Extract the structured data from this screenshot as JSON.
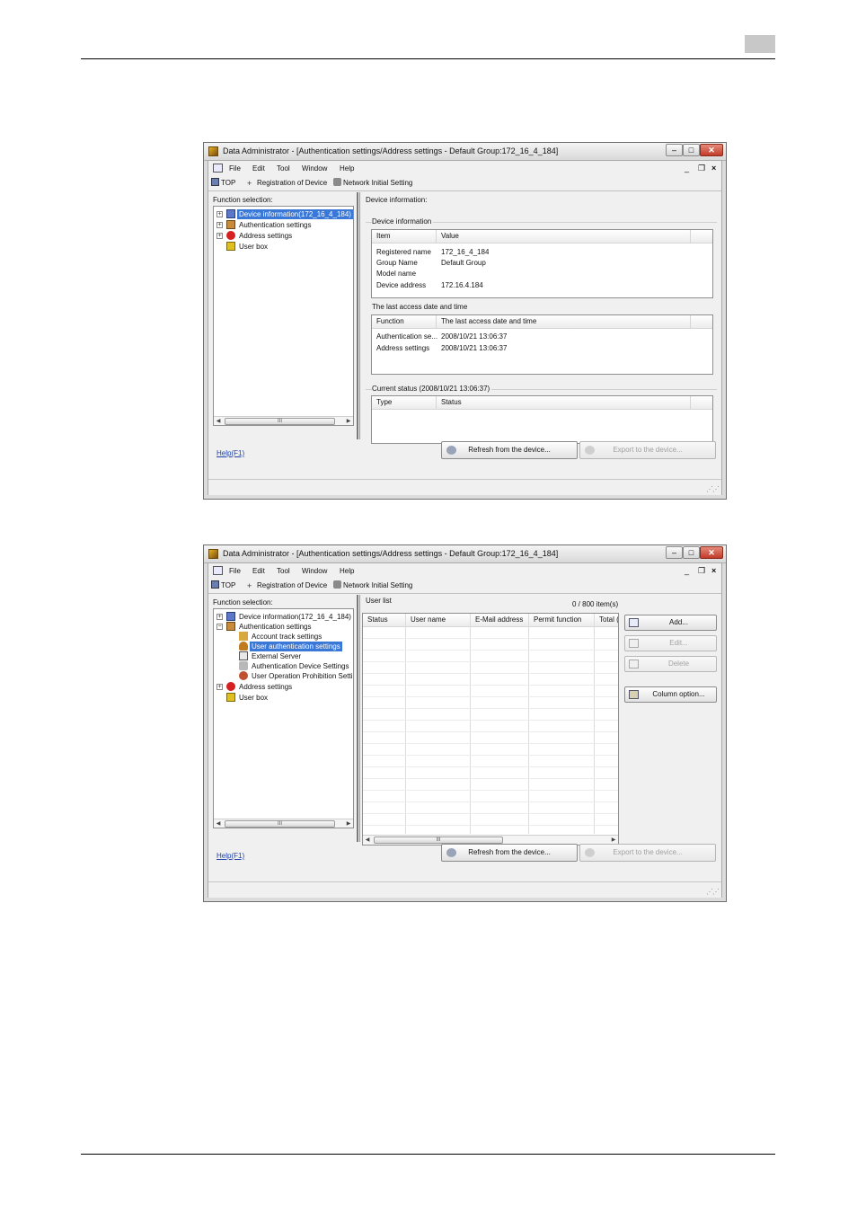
{
  "window1": {
    "title": "Data Administrator - [Authentication settings/Address settings - Default Group:172_16_4_184]",
    "menu": [
      "File",
      "Edit",
      "Tool",
      "Window",
      "Help"
    ],
    "toolbar": {
      "top": "TOP",
      "registration": "Registration of Device",
      "network": "Network Initial Setting"
    },
    "function_selection": "Function selection:",
    "tree": [
      {
        "label": "Device information(172_16_4_184)",
        "selected": true
      },
      {
        "label": "Authentication settings"
      },
      {
        "label": "Address settings"
      },
      {
        "label": "User box"
      }
    ],
    "panel_title": "Device information:",
    "device_info": {
      "group": "Device information",
      "headers": [
        "Item",
        "Value"
      ],
      "rows": [
        [
          "Registered name",
          "172_16_4_184"
        ],
        [
          "Group Name",
          "Default Group"
        ],
        [
          "Model name",
          ""
        ],
        [
          "Device address",
          "172.16.4.184"
        ]
      ]
    },
    "last_access": {
      "group": "The last access date and time",
      "headers": [
        "Function",
        "The last access date and time"
      ],
      "rows": [
        [
          "Authentication se...",
          "2008/10/21 13:06:37"
        ],
        [
          "Address settings",
          "2008/10/21 13:06:37"
        ]
      ]
    },
    "current_status": {
      "group": "Current status (2008/10/21 13:06:37)",
      "headers": [
        "Type",
        "Status"
      ]
    },
    "help": "Help(F1)",
    "refresh": "Refresh from the device...",
    "export": "Export to the device..."
  },
  "window2": {
    "title": "Data Administrator - [Authentication settings/Address settings - Default Group:172_16_4_184]",
    "menu": [
      "File",
      "Edit",
      "Tool",
      "Window",
      "Help"
    ],
    "toolbar": {
      "top": "TOP",
      "registration": "Registration of Device",
      "network": "Network Initial Setting"
    },
    "function_selection": "Function selection:",
    "tree": [
      {
        "label": "Device information(172_16_4_184)"
      },
      {
        "label": "Authentication settings"
      },
      {
        "label": "Account track settings"
      },
      {
        "label": "User authentication settings",
        "selected": true
      },
      {
        "label": "External Server"
      },
      {
        "label": "Authentication Device Settings"
      },
      {
        "label": "User Operation Prohibition Settin"
      },
      {
        "label": "Address settings"
      },
      {
        "label": "User box"
      }
    ],
    "user_list": {
      "label": "User list",
      "count": "0 / 800 item(s)",
      "headers": [
        "Status",
        "User name",
        "E-Mail address",
        "Permit function",
        "Total (I"
      ]
    },
    "buttons": {
      "add": "Add...",
      "edit": "Edit...",
      "delete": "Delete",
      "column": "Column option..."
    },
    "help": "Help(F1)",
    "refresh": "Refresh from the device...",
    "export": "Export to the device..."
  },
  "scroll_thumb": "III"
}
